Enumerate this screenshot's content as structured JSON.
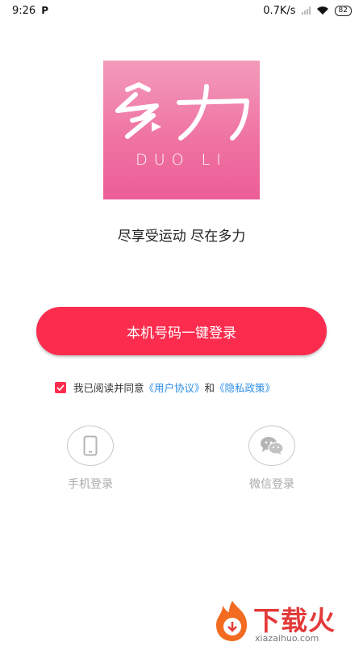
{
  "status": {
    "time": "9:26",
    "p_badge": "P",
    "net_speed": "0.7K/s",
    "battery": "82"
  },
  "logo": {
    "subtitle": "DUO LI"
  },
  "slogan": "尽享受运动 尽在多力",
  "primary_button": "本机号码一键登录",
  "agreement": {
    "checked": true,
    "prefix": "我已阅读并同意",
    "user_agreement": "《用户协议》",
    "joiner": "和",
    "privacy_policy": "《隐私政策》"
  },
  "alt_logins": {
    "phone": "手机登录",
    "wechat": "微信登录"
  },
  "watermark": {
    "title": "下载火",
    "url": "xiazaihuo.com"
  },
  "colors": {
    "accent": "#fb2c4e",
    "link": "#2c8ee8",
    "logo_pink": "#ef74a3"
  }
}
